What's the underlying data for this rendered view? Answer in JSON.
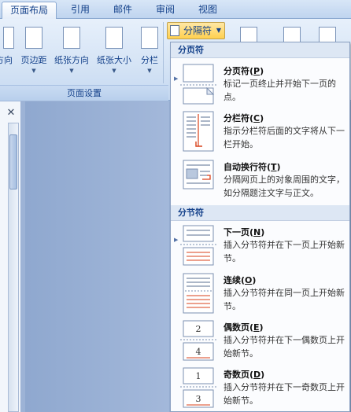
{
  "tabs": [
    {
      "label": "页面布局",
      "active": true
    },
    {
      "label": "引用",
      "active": false
    },
    {
      "label": "邮件",
      "active": false
    },
    {
      "label": "审阅",
      "active": false
    },
    {
      "label": "视图",
      "active": false
    }
  ],
  "ribbon": {
    "buttons": [
      {
        "label": "方向"
      },
      {
        "label": "页边距"
      },
      {
        "label": "纸张方向"
      },
      {
        "label": "纸张大小"
      },
      {
        "label": "分栏"
      }
    ],
    "group_caption": "页面设置",
    "breaks_button_label": "分隔符"
  },
  "menu": {
    "page_breaks_header": "分页符",
    "section_breaks_header": "分节符",
    "items": [
      {
        "title": "分页符",
        "key": "P",
        "desc": "标记一页终止并开始下一页的点。"
      },
      {
        "title": "分栏符",
        "key": "C",
        "desc": "指示分栏符后面的文字将从下一栏开始。"
      },
      {
        "title": "自动换行符",
        "key": "T",
        "desc": "分隔网页上的对象周围的文字，如分隔题注文字与正文。"
      },
      {
        "title": "下一页",
        "key": "N",
        "desc": "插入分节符并在下一页上开始新节。"
      },
      {
        "title": "连续",
        "key": "O",
        "desc": "插入分节符并在同一页上开始新节。"
      },
      {
        "title": "偶数页",
        "key": "E",
        "desc": "插入分节符并在下一偶数页上开始新节。",
        "icon_number": "2"
      },
      {
        "title": "奇数页",
        "key": "D",
        "desc": "插入分节符并在下一奇数页上开始新节。",
        "icon_number": "1"
      }
    ],
    "even_icon_numbers": [
      "2",
      "4"
    ],
    "odd_icon_numbers": [
      "1",
      "3"
    ]
  },
  "colors": {
    "accent": "#15428b",
    "highlight": "#ffd04f",
    "menu_header_bg": "#dde7f4"
  }
}
